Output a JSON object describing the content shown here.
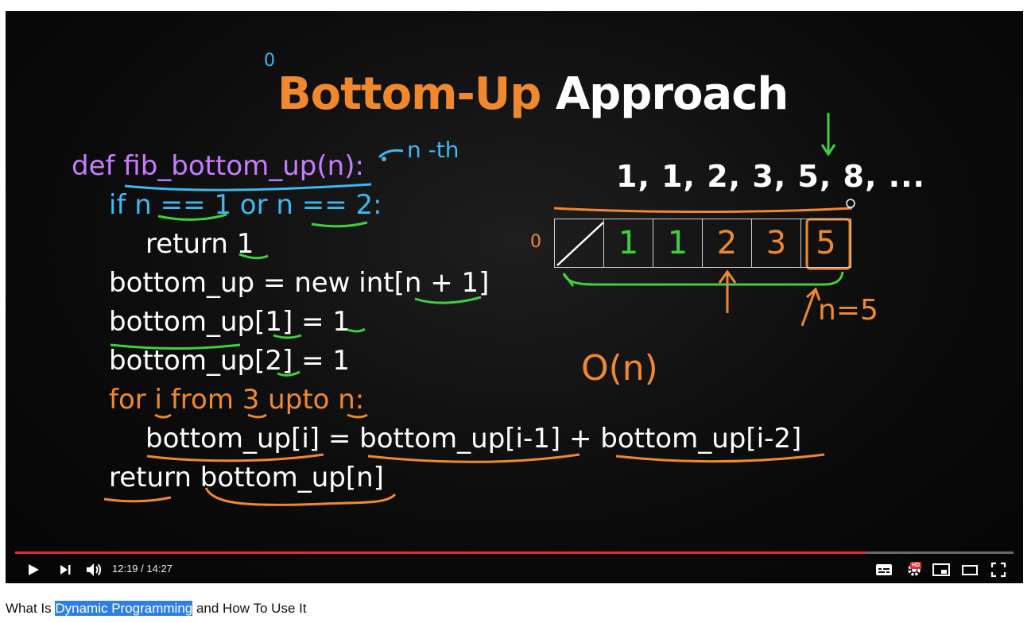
{
  "slide": {
    "title_accent": "Bottom-Up",
    "title_rest": "Approach",
    "code_lines": [
      "def fib_bottom_up(n):",
      "if n == 1 or n == 2:",
      "return 1",
      "bottom_up = new int[n + 1]",
      "bottom_up[1] = 1",
      "bottom_up[2] = 1",
      "for i from 3 upto n:",
      "bottom_up[i] = bottom_up[i-1] + bottom_up[i-2]",
      "return bottom_up[n]"
    ],
    "sequence": "1, 1, 2, 3, 5, 8, ...",
    "array_cells": [
      "",
      "1",
      "1",
      "2",
      "3",
      "5"
    ],
    "annotations": {
      "nth": "n -th",
      "n_equals": "n=5",
      "complexity": "O(n)",
      "zero_top": "0",
      "zero_left": "0"
    },
    "colors": {
      "def": "#c77dff",
      "if": "#3fb7f0",
      "for": "#f0892d",
      "default": "#ffffff",
      "green": "#3fd03f",
      "orange": "#f0892d",
      "blue": "#3fb7f0"
    }
  },
  "player": {
    "current_time": "12:19",
    "duration": "14:27",
    "time_text": "12:19 / 14:27",
    "progress": 0.852,
    "hd_badge": "HD",
    "icons": [
      "play-icon",
      "next-icon",
      "volume-icon",
      "subtitles-icon",
      "settings-icon",
      "miniplayer-icon",
      "theater-icon",
      "fullscreen-icon"
    ]
  },
  "video": {
    "title_before": "What Is ",
    "title_highlight": "Dynamic Programming",
    "title_after": " and How To Use It"
  }
}
